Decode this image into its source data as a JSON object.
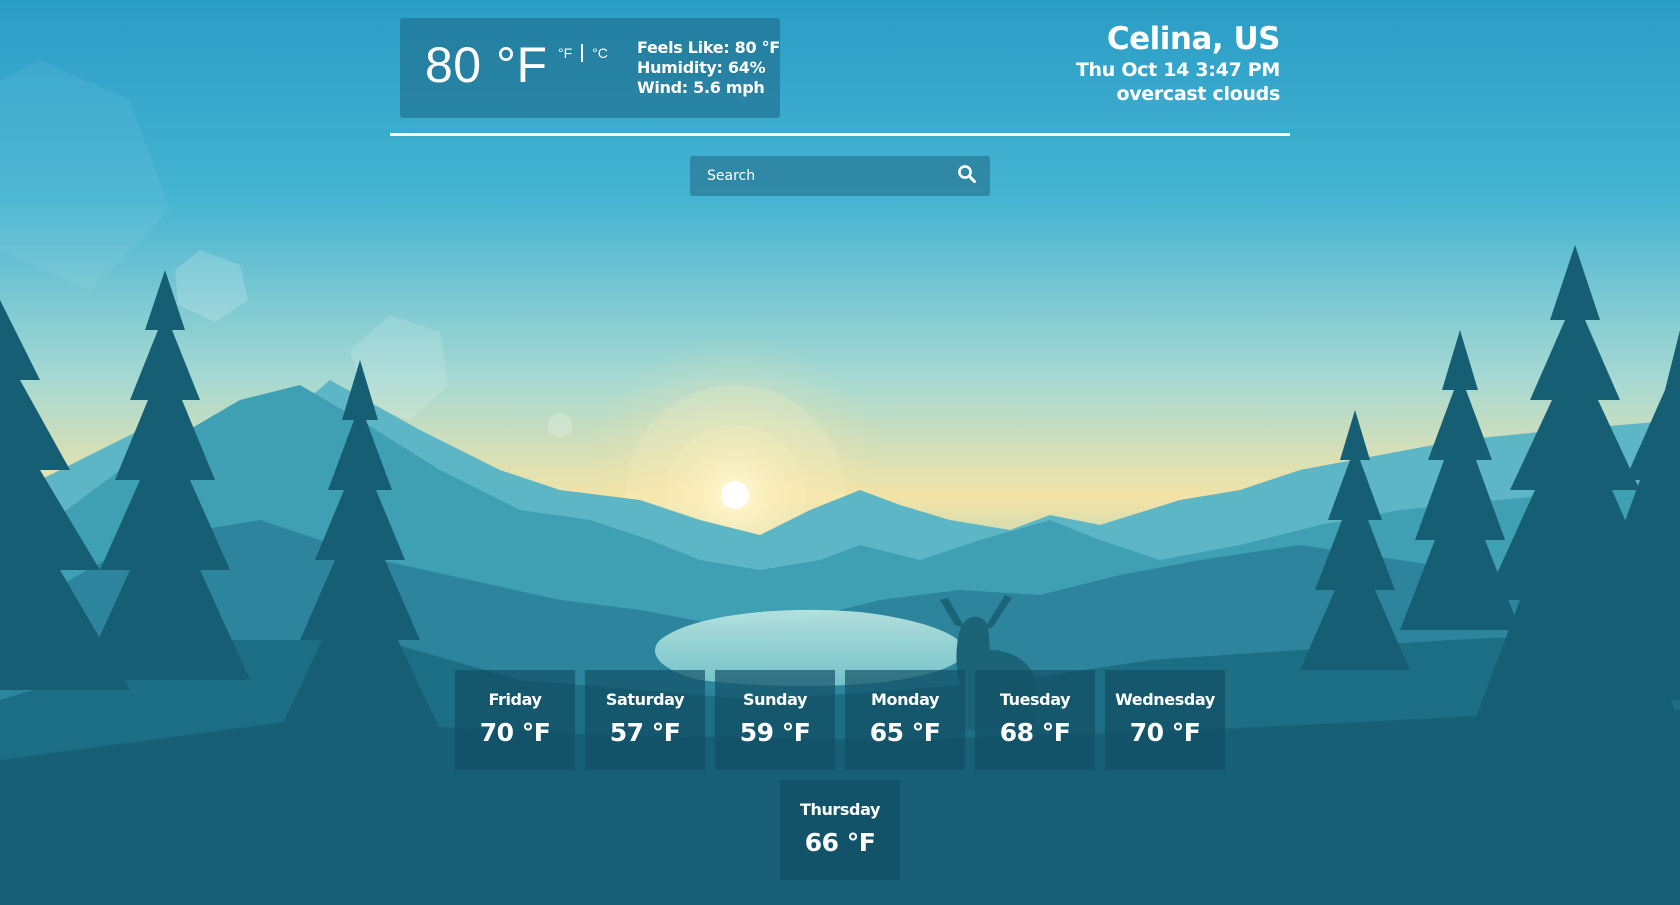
{
  "current": {
    "temperature": "80 °F",
    "unit_fahrenheit": "°F",
    "unit_celsius": "°C",
    "feels_like": "Feels Like: 80 °F",
    "humidity": "Humidity: 64%",
    "wind": "Wind: 5.6 mph"
  },
  "location": {
    "city": "Celina, US",
    "datetime": "Thu Oct 14 3:47 PM",
    "condition": "overcast clouds"
  },
  "search": {
    "placeholder": "Search",
    "value": ""
  },
  "icons": {
    "search": "search-icon"
  },
  "forecast": [
    {
      "day": "Friday",
      "temp": "70 °F"
    },
    {
      "day": "Saturday",
      "temp": "57 °F"
    },
    {
      "day": "Sunday",
      "temp": "59 °F"
    },
    {
      "day": "Monday",
      "temp": "65 °F"
    },
    {
      "day": "Tuesday",
      "temp": "68 °F"
    },
    {
      "day": "Wednesday",
      "temp": "70 °F"
    },
    {
      "day": "Thursday",
      "temp": "66 °F"
    }
  ],
  "colors": {
    "sky_top": "#2A9DC6",
    "sky_mid": "#8FD0D3",
    "horizon": "#F3E3A6",
    "tree_dark": "#145A6E",
    "card_bg": "#1F6C8A"
  }
}
